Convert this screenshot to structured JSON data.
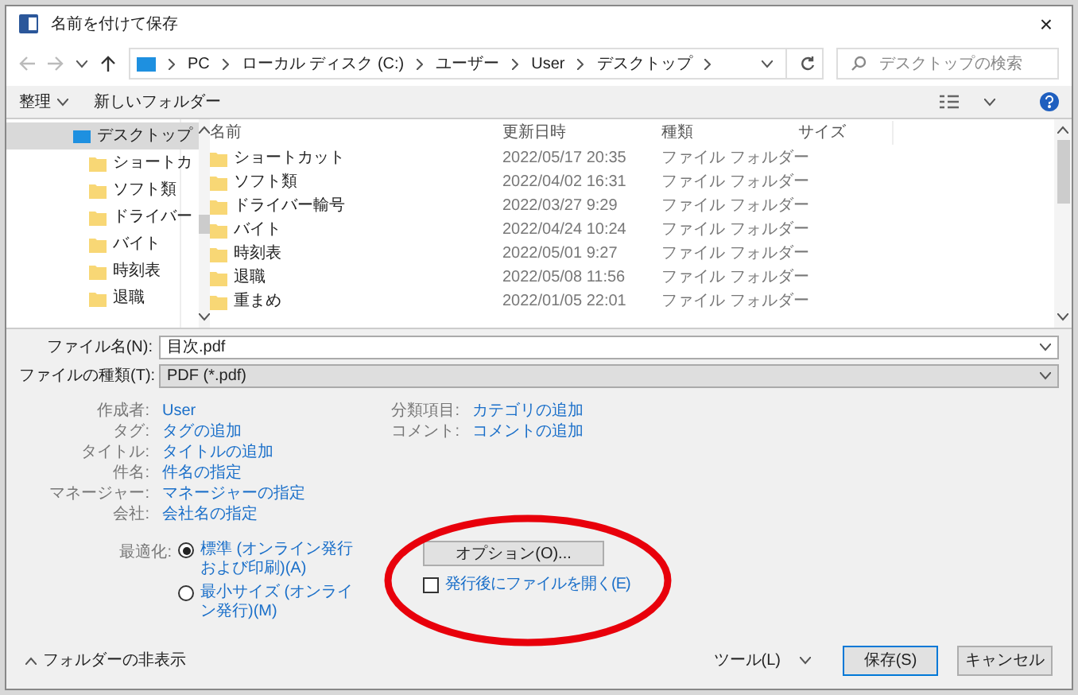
{
  "window": {
    "title": "名前を付けて保存",
    "close": "×"
  },
  "address": {
    "crumbs": [
      "PC",
      "ローカル ディスク (C:)",
      "ユーザー",
      "User",
      "デスクトップ"
    ],
    "search_placeholder": "デスクトップの検索"
  },
  "toolbar": {
    "organize": "整理",
    "new_folder": "新しいフォルダー"
  },
  "sidebar": {
    "items": [
      {
        "label": "デスクトップ",
        "selected": true,
        "kind": "desktop"
      },
      {
        "label": "ショートカ",
        "selected": false,
        "kind": "folder"
      },
      {
        "label": "ソフト類",
        "selected": false,
        "kind": "folder"
      },
      {
        "label": "ドライバー",
        "selected": false,
        "kind": "folder"
      },
      {
        "label": "バイト",
        "selected": false,
        "kind": "folder"
      },
      {
        "label": "時刻表",
        "selected": false,
        "kind": "folder"
      },
      {
        "label": "退職",
        "selected": false,
        "kind": "folder"
      }
    ]
  },
  "table": {
    "columns": [
      "名前",
      "更新日時",
      "種類",
      "サイズ"
    ],
    "rows": [
      {
        "name": "ショートカット",
        "date": "2022/05/17 20:35",
        "type": "ファイル フォルダー"
      },
      {
        "name": "ソフト類",
        "date": "2022/04/02 16:31",
        "type": "ファイル フォルダー"
      },
      {
        "name": "ドライバー輸号",
        "date": "2022/03/27 9:29",
        "type": "ファイル フォルダー"
      },
      {
        "name": "バイト",
        "date": "2022/04/24 10:24",
        "type": "ファイル フォルダー"
      },
      {
        "name": "時刻表",
        "date": "2022/05/01 9:27",
        "type": "ファイル フォルダー"
      },
      {
        "name": "退職",
        "date": "2022/05/08 11:56",
        "type": "ファイル フォルダー"
      },
      {
        "name": "重まめ",
        "date": "2022/01/05 22:01",
        "type": "ファイル フォルダー"
      }
    ]
  },
  "file_name": {
    "label": "ファイル名(N):",
    "value": "目次.pdf"
  },
  "file_type": {
    "label": "ファイルの種類(T):",
    "value": "PDF (*.pdf)"
  },
  "properties_left": [
    {
      "label": "作成者:",
      "value": "User"
    },
    {
      "label": "タグ:",
      "value": "タグの追加"
    },
    {
      "label": "タイトル:",
      "value": "タイトルの追加"
    },
    {
      "label": "件名:",
      "value": "件名の指定"
    },
    {
      "label": "マネージャー:",
      "value": "マネージャーの指定"
    },
    {
      "label": "会社:",
      "value": "会社名の指定"
    }
  ],
  "properties_right": [
    {
      "label": "分類項目:",
      "value": "カテゴリの追加"
    },
    {
      "label": "コメント:",
      "value": "コメントの追加"
    }
  ],
  "optimize": {
    "label": "最適化:",
    "options": [
      {
        "label": "標準 (オンライン発行および印刷)(A)",
        "selected": true
      },
      {
        "label": "最小サイズ (オンライン発行)(M)",
        "selected": false
      }
    ]
  },
  "options_button": "オプション(O)...",
  "open_after": {
    "label": "発行後にファイルを開く(E)",
    "checked": false
  },
  "footer": {
    "hide_folders": "フォルダーの非表示",
    "tools": "ツール(L)",
    "save": "保存(S)",
    "cancel": "キャンセル"
  }
}
